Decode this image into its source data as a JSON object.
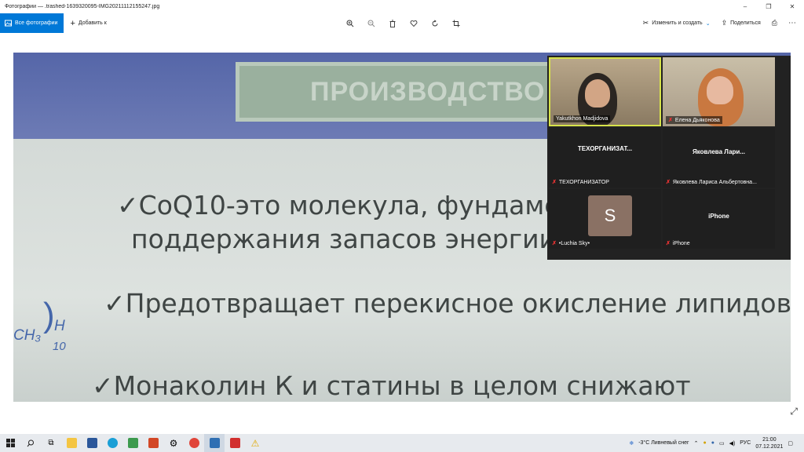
{
  "window": {
    "title": "Фотографии — .trashed-1639320095-IMG20211112155247.jpg",
    "minimize": "–",
    "maximize": "❐",
    "close": "✕"
  },
  "toolbar": {
    "all_photos": "Все фотографии",
    "add_to": "Добавить к",
    "edit_create": "Изменить и создать",
    "share": "Поделиться"
  },
  "slide": {
    "heading": "ПРОИЗВОДСТВО",
    "line1": "✓CoQ10-это молекула, фундамент",
    "line2": "поддержания запасов энергии в наших клетках.",
    "line3": "✓Предотвращает перекисное окисление липидов",
    "line4": "✓Монаколин К и статины в целом снижают",
    "chem_ch3": "CH₃",
    "chem_h": "H",
    "chem_10": "10"
  },
  "zoom": {
    "participants": [
      {
        "label": "Yakutkhon Madjidova",
        "muted": false
      },
      {
        "label": "Елена Дьяконова",
        "muted": true
      },
      {
        "name": "ТЕХОРГАНИЗАТ...",
        "label": "ТЕХОРГАНИЗАТОР",
        "muted": true
      },
      {
        "name": "Яковлева Лари...",
        "label": "Яковлева Лариса Альбертовна...",
        "muted": true
      },
      {
        "avatar": "S",
        "label": "•Luchia Sky•",
        "muted": true
      },
      {
        "name": "iPhone",
        "label": "iPhone",
        "muted": true
      }
    ]
  },
  "taskbar": {
    "weather": "-3°C  Ливневый снег",
    "lang": "РУС",
    "time": "21:00",
    "date": "07.12.2021"
  },
  "colors": {
    "accent": "#0078d7",
    "slide_header": "#5566a8",
    "muted_icon": "#e33333"
  }
}
